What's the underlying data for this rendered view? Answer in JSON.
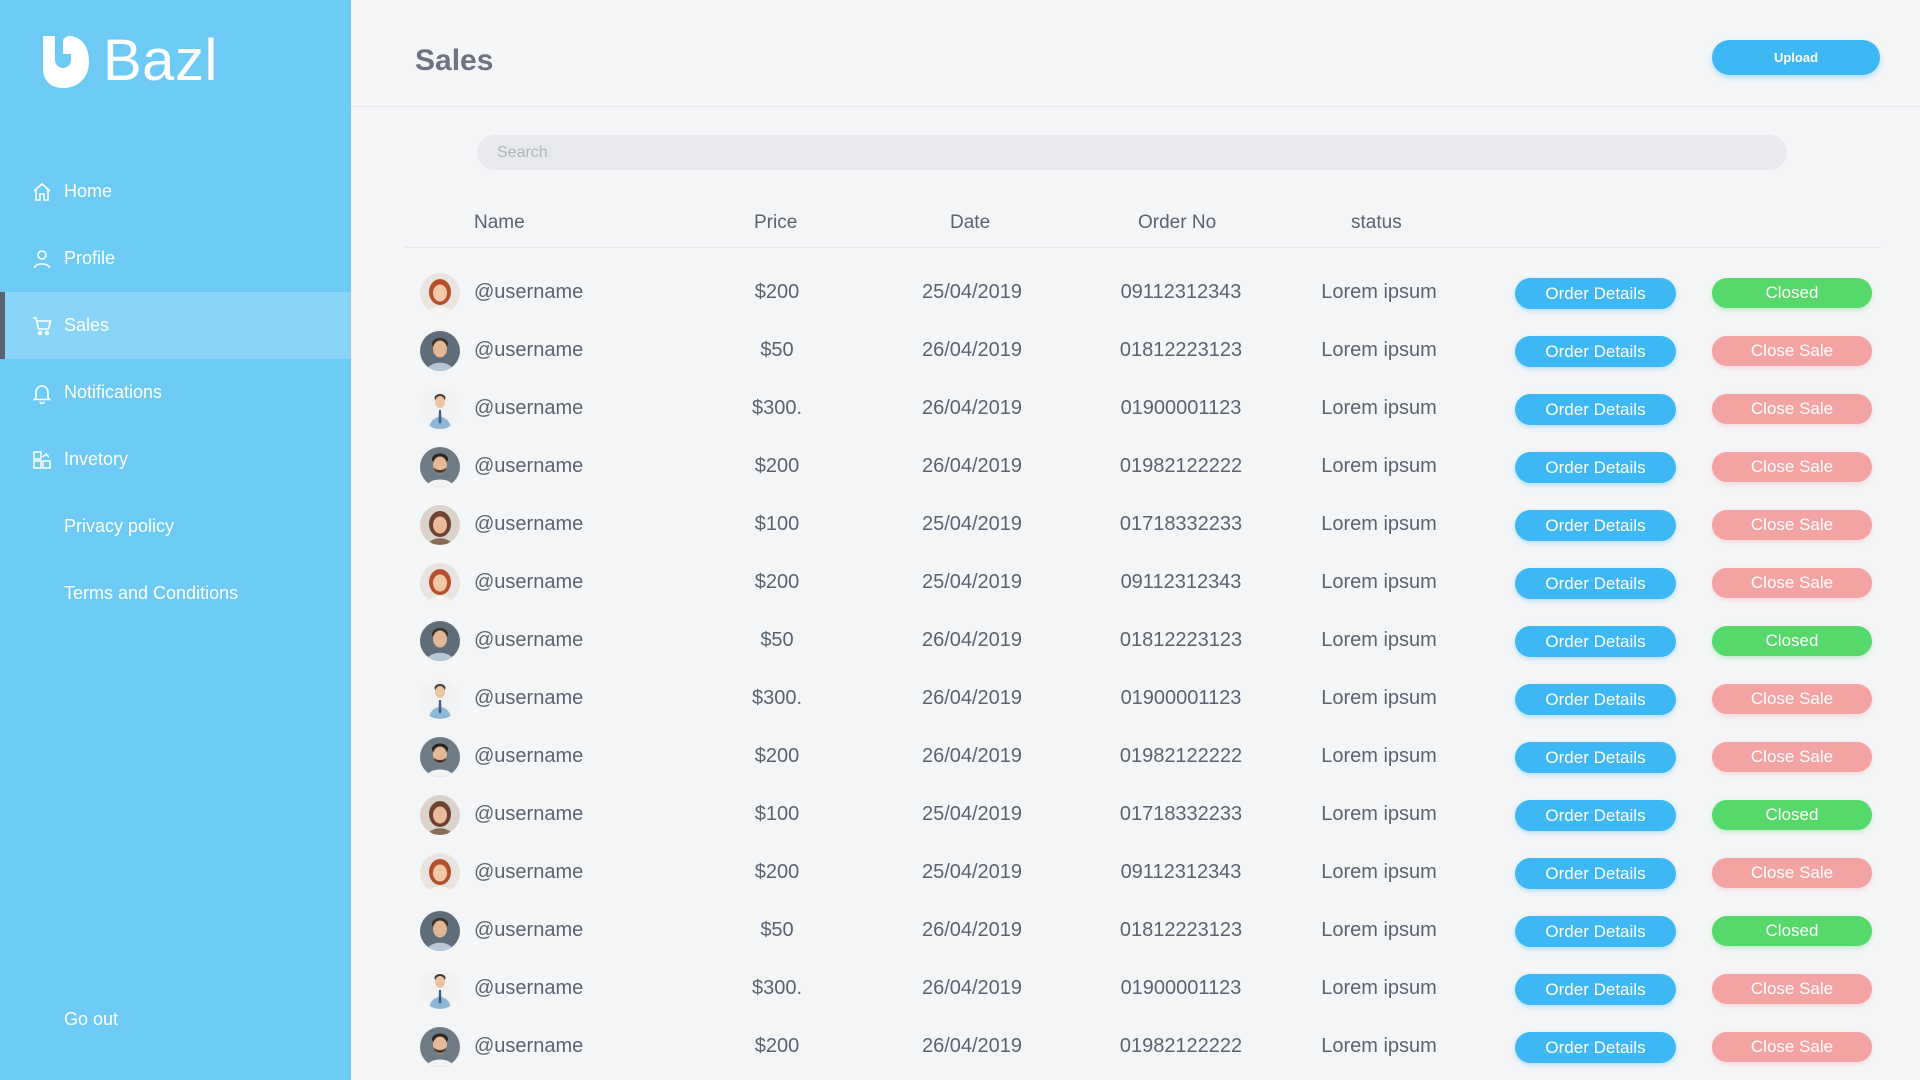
{
  "app": {
    "name": "Bazl"
  },
  "sidebar": {
    "items": [
      {
        "label": "Home",
        "icon": "home-icon"
      },
      {
        "label": "Profile",
        "icon": "user-icon"
      },
      {
        "label": "Sales",
        "icon": "cart-icon",
        "active": true
      },
      {
        "label": "Notifications",
        "icon": "bell-icon"
      },
      {
        "label": "Invetory",
        "icon": "inventory-icon"
      },
      {
        "label": "Privacy policy"
      },
      {
        "label": "Terms and Conditions"
      }
    ],
    "go_out": "Go out"
  },
  "header": {
    "title": "Sales",
    "upload_label": "Upload"
  },
  "search": {
    "placeholder": "Search"
  },
  "table": {
    "columns": [
      "Name",
      "Price",
      "Date",
      "Order No",
      "status"
    ],
    "details_label": "Order Details",
    "rows": [
      {
        "avatar": "woman-red",
        "name": "@username",
        "price": "$200",
        "date": "25/04/2019",
        "order_no": "09112312343",
        "status": "Lorem ipsum",
        "action": "Closed"
      },
      {
        "avatar": "man-casual",
        "name": "@username",
        "price": "$50",
        "date": "26/04/2019",
        "order_no": "01812223123",
        "status": "Lorem ipsum",
        "action": "Close Sale"
      },
      {
        "avatar": "man-suit",
        "name": "@username",
        "price": "$300.",
        "date": "26/04/2019",
        "order_no": "01900001123",
        "status": "Lorem ipsum",
        "action": "Close Sale"
      },
      {
        "avatar": "man-beard",
        "name": "@username",
        "price": "$200",
        "date": "26/04/2019",
        "order_no": "01982122222",
        "status": "Lorem ipsum",
        "action": "Close Sale"
      },
      {
        "avatar": "woman-brown",
        "name": "@username",
        "price": "$100",
        "date": "25/04/2019",
        "order_no": "01718332233",
        "status": "Lorem ipsum",
        "action": "Close Sale"
      },
      {
        "avatar": "woman-red",
        "name": "@username",
        "price": "$200",
        "date": "25/04/2019",
        "order_no": "09112312343",
        "status": "Lorem ipsum",
        "action": "Close Sale"
      },
      {
        "avatar": "man-casual",
        "name": "@username",
        "price": "$50",
        "date": "26/04/2019",
        "order_no": "01812223123",
        "status": "Lorem ipsum",
        "action": "Closed"
      },
      {
        "avatar": "man-suit",
        "name": "@username",
        "price": "$300.",
        "date": "26/04/2019",
        "order_no": "01900001123",
        "status": "Lorem ipsum",
        "action": "Close Sale"
      },
      {
        "avatar": "man-beard",
        "name": "@username",
        "price": "$200",
        "date": "26/04/2019",
        "order_no": "01982122222",
        "status": "Lorem ipsum",
        "action": "Close Sale"
      },
      {
        "avatar": "woman-brown",
        "name": "@username",
        "price": "$100",
        "date": "25/04/2019",
        "order_no": "01718332233",
        "status": "Lorem ipsum",
        "action": "Closed"
      },
      {
        "avatar": "woman-red",
        "name": "@username",
        "price": "$200",
        "date": "25/04/2019",
        "order_no": "09112312343",
        "status": "Lorem ipsum",
        "action": "Close Sale"
      },
      {
        "avatar": "man-casual",
        "name": "@username",
        "price": "$50",
        "date": "26/04/2019",
        "order_no": "01812223123",
        "status": "Lorem ipsum",
        "action": "Closed"
      },
      {
        "avatar": "man-suit",
        "name": "@username",
        "price": "$300.",
        "date": "26/04/2019",
        "order_no": "01900001123",
        "status": "Lorem ipsum",
        "action": "Close Sale"
      },
      {
        "avatar": "man-beard",
        "name": "@username",
        "price": "$200",
        "date": "26/04/2019",
        "order_no": "01982122222",
        "status": "Lorem ipsum",
        "action": "Close Sale"
      }
    ]
  },
  "colors": {
    "sidebar": "#6ccaf5",
    "accent": "#3db8f5",
    "closed": "#56d86a",
    "close_sale": "#f4a3a3"
  }
}
